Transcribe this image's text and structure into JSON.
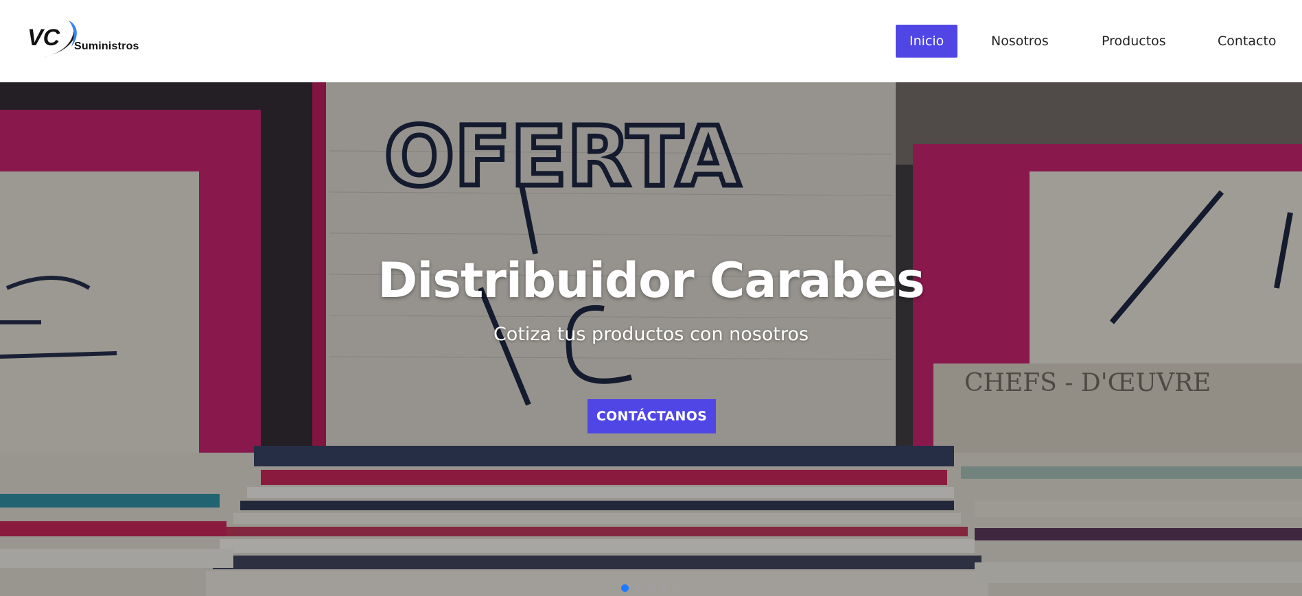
{
  "header": {
    "logo_text": "Suministros",
    "logo_mark": "VC"
  },
  "nav": {
    "items": [
      {
        "label": "Inicio",
        "active": true
      },
      {
        "label": "Nosotros",
        "active": false
      },
      {
        "label": "Productos",
        "active": false
      },
      {
        "label": "Contacto",
        "active": false
      }
    ]
  },
  "hero": {
    "title": "Distribuidor Carabes",
    "subtitle": "Cotiza tus productos con nosotros",
    "cta_label": "CONTÁCTANOS",
    "slide_count": 5,
    "active_slide": 1,
    "image_sign_text": "OFERTA"
  },
  "colors": {
    "accent": "#4f46e5",
    "dot_active": "#1e7bff"
  }
}
